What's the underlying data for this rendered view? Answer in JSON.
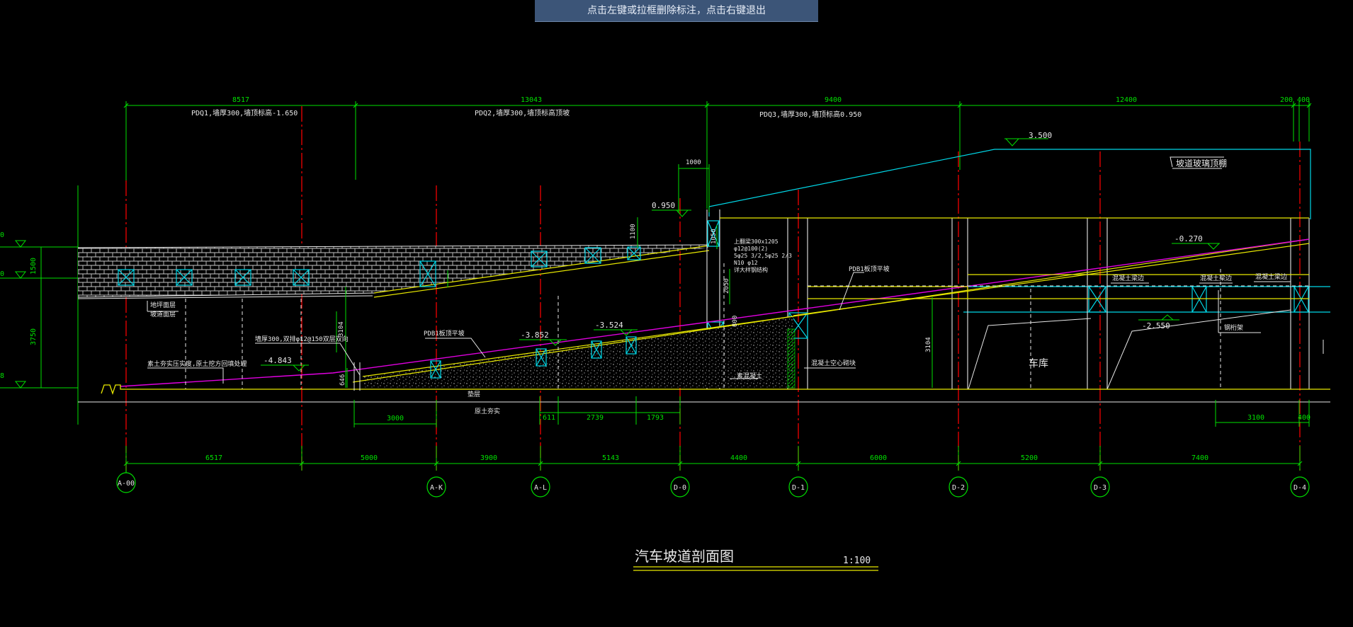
{
  "banner": {
    "text": "点击左键或拉框删除标注，点击右键退出"
  },
  "colors": {
    "bg": "#000000",
    "green": "#00e000",
    "red": "#e00000",
    "yellow": "#e8e800",
    "cyan": "#00d8e8",
    "magenta": "#e000e0",
    "white": "#e8e8e8",
    "banner": "#3c5578"
  },
  "top_dims": [
    "8517",
    "13043",
    "9400",
    "12400",
    "200",
    "400"
  ],
  "walls": {
    "w1": "PDQ1,墙厚300,墙顶标高-1.650",
    "w2": "PDQ2,墙厚300,墙顶标高顶坡",
    "w3": "PDQ3,墙厚300,墙顶标高0.950"
  },
  "elevations": {
    "e1": "3.500",
    "e2": "0.950",
    "e3": "-0.270",
    "e4": "-3.524",
    "e5": "-3.852",
    "e6": "-4.843",
    "e7": "-2.550"
  },
  "left_edge": {
    "t1": "0",
    "t2": "0",
    "t3": "8"
  },
  "left_dims": {
    "d1": "1500",
    "d2": "3750"
  },
  "small_dims": {
    "d1000": "1000",
    "d1100": "1100",
    "d1050": "1050",
    "d2050": "2050",
    "d3104a": "3104",
    "d3104b": "3104",
    "d646": "646",
    "d800": "800"
  },
  "labels": {
    "roof": "坡道玻璃顶棚",
    "rebar1": "上翻梁300x1205",
    "rebar2": "φ12@100(2)",
    "rebar3": "5φ25 3/2,5φ25 2/3",
    "rebar4": "N10 φ12",
    "rebar5": "详大样钢结构",
    "pdb1": "PDB1板顶平坡",
    "pdb2": "PDB1板顶平坡",
    "beam1": "混凝土梁边",
    "beam2": "混凝土梁边",
    "beam3": "混凝土梁边",
    "steel": "钢桁架",
    "garage": "车库",
    "wall_note": "墙厚300,双排φ12@150双层双向",
    "soil_note": "素土夯实压实度,原土挖方回填处理",
    "plain": "素混凝土",
    "hollow": "混凝土空心砌块",
    "flat1": "地坪面层",
    "flat2": "坡道面层",
    "cushion": "垫层",
    "base": "原土夯实"
  },
  "segment_dims": [
    "3000",
    "611",
    "2739",
    "1793",
    "3100",
    "400"
  ],
  "bottom_dims": [
    "6517",
    "5000",
    "3900",
    "5143",
    "4400",
    "6000",
    "5200",
    "7400"
  ],
  "axes": [
    "A-00",
    "A-K",
    "A-L",
    "D-0",
    "D-1",
    "D-2",
    "D-3",
    "D-4"
  ],
  "title": {
    "text": "汽车坡道剖面图",
    "scale": "1:100"
  }
}
